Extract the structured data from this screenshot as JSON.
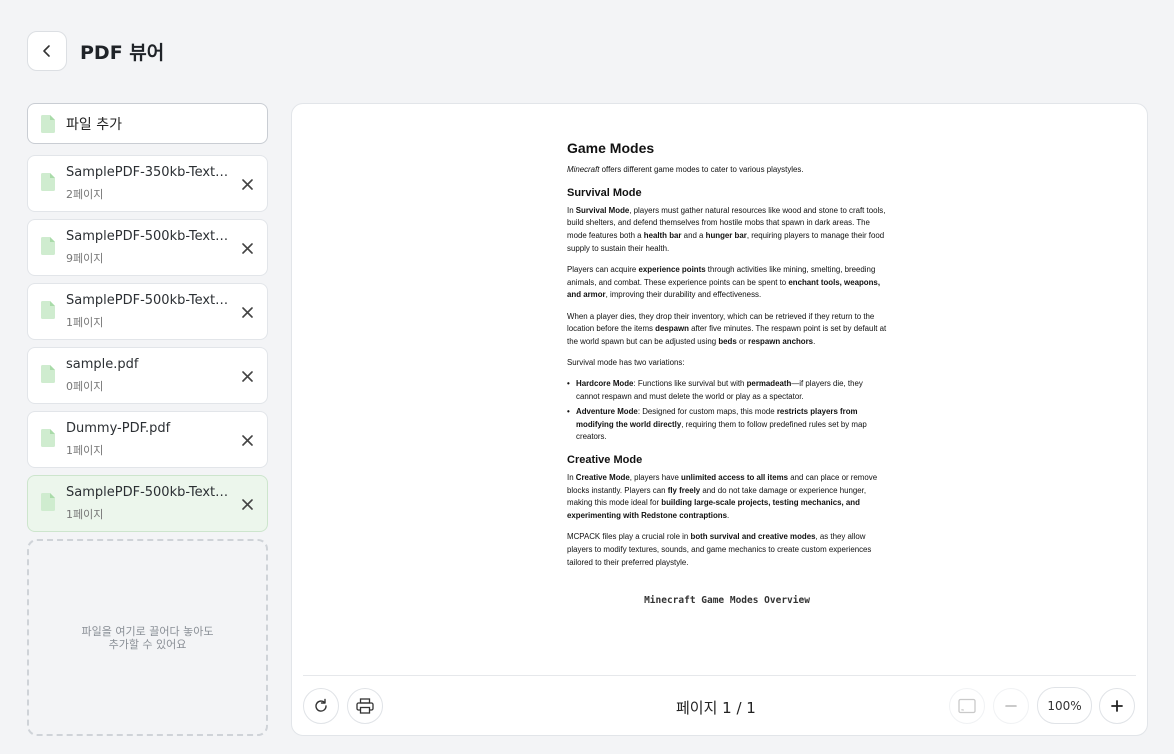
{
  "header": {
    "title": "PDF 뷰어",
    "back_icon": "chevron-left-icon"
  },
  "sidebar": {
    "add_file_label": "파일 추가",
    "files": [
      {
        "name": "SamplePDF-350kb-Text-Im...",
        "pages": "2페이지",
        "selected": false
      },
      {
        "name": "SamplePDF-500kb-Text-Im...",
        "pages": "9페이지",
        "selected": false
      },
      {
        "name": "SamplePDF-500kb-Text-Im...",
        "pages": "1페이지",
        "selected": false
      },
      {
        "name": "sample.pdf",
        "pages": "0페이지",
        "selected": false
      },
      {
        "name": "Dummy-PDF.pdf",
        "pages": "1페이지",
        "selected": false
      },
      {
        "name": "SamplePDF-500kb-Text-Im...",
        "pages": "1페이지",
        "selected": true
      }
    ],
    "dropzone_text": "파일을 여기로 끌어다 놓아도\n추가할 수 있어요"
  },
  "document": {
    "title": "Game Modes",
    "intro_em": "Minecraft",
    "intro_rest": " offers different game modes to cater to various playstyles.",
    "survival_heading": "Survival Mode",
    "survival_p1": [
      [
        "In ",
        false
      ],
      [
        "Survival Mode",
        true
      ],
      [
        ", players must gather natural resources like wood and stone to craft tools, build shelters, and defend themselves from hostile mobs that spawn in dark areas. The mode features both a ",
        false
      ],
      [
        "health bar",
        true
      ],
      [
        " and a ",
        false
      ],
      [
        "hunger bar",
        true
      ],
      [
        ", requiring players to manage their food supply to sustain their health.",
        false
      ]
    ],
    "survival_p2": [
      [
        "Players can acquire ",
        false
      ],
      [
        "experience points",
        true
      ],
      [
        " through activities like mining, smelting, breeding animals, and combat. These experience points can be spent to ",
        false
      ],
      [
        "enchant tools, weapons, and armor",
        true
      ],
      [
        ", improving their durability and effectiveness.",
        false
      ]
    ],
    "survival_p3": [
      [
        "When a player dies, they drop their inventory, which can be retrieved if they return to the location before the items ",
        false
      ],
      [
        "despawn",
        true
      ],
      [
        " after five minutes. The respawn point is set by default at the world spawn but can be adjusted using ",
        false
      ],
      [
        "beds",
        true
      ],
      [
        " or ",
        false
      ],
      [
        "respawn anchors",
        true
      ],
      [
        ".",
        false
      ]
    ],
    "survival_p4": "Survival mode has two variations:",
    "variations": [
      [
        [
          "Hardcore Mode",
          true
        ],
        [
          ": Functions like survival but with ",
          false
        ],
        [
          "permadeath",
          true
        ],
        [
          "—if players die, they cannot respawn and must delete the world or play as a spectator.",
          false
        ]
      ],
      [
        [
          "Adventure Mode",
          true
        ],
        [
          ": Designed for custom maps, this mode ",
          false
        ],
        [
          "restricts players from modifying the world directly",
          true
        ],
        [
          ", requiring them to follow predefined rules set by map creators.",
          false
        ]
      ]
    ],
    "creative_heading": "Creative Mode",
    "creative_p1": [
      [
        "In ",
        false
      ],
      [
        "Creative Mode",
        true
      ],
      [
        ", players have ",
        false
      ],
      [
        "unlimited access to all items",
        true
      ],
      [
        " and can place or remove blocks instantly. Players can ",
        false
      ],
      [
        "fly freely",
        true
      ],
      [
        " and do not take damage or experience hunger, making this mode ideal for ",
        false
      ],
      [
        "building large-scale projects, testing mechanics, and experimenting with Redstone contraptions",
        true
      ],
      [
        ".",
        false
      ]
    ],
    "creative_p2": [
      [
        "MCPACK files play a crucial role in ",
        false
      ],
      [
        "both survival and creative modes",
        true
      ],
      [
        ", as they allow players to modify textures, sounds, and game mechanics to create custom experiences tailored to their preferred playstyle.",
        false
      ]
    ],
    "caption": "Minecraft Game Modes Overview"
  },
  "toolbar": {
    "page_indicator": "페이지 1 / 1",
    "zoom": "100%",
    "icons": [
      "rotate-icon",
      "print-icon",
      "fit-page-icon",
      "zoom-out-icon",
      "zoom-in-icon"
    ]
  },
  "colors": {
    "file_icon": "#bfe3bf",
    "selected_bg": "#ecf6ec",
    "background": "#f3f4f6"
  }
}
